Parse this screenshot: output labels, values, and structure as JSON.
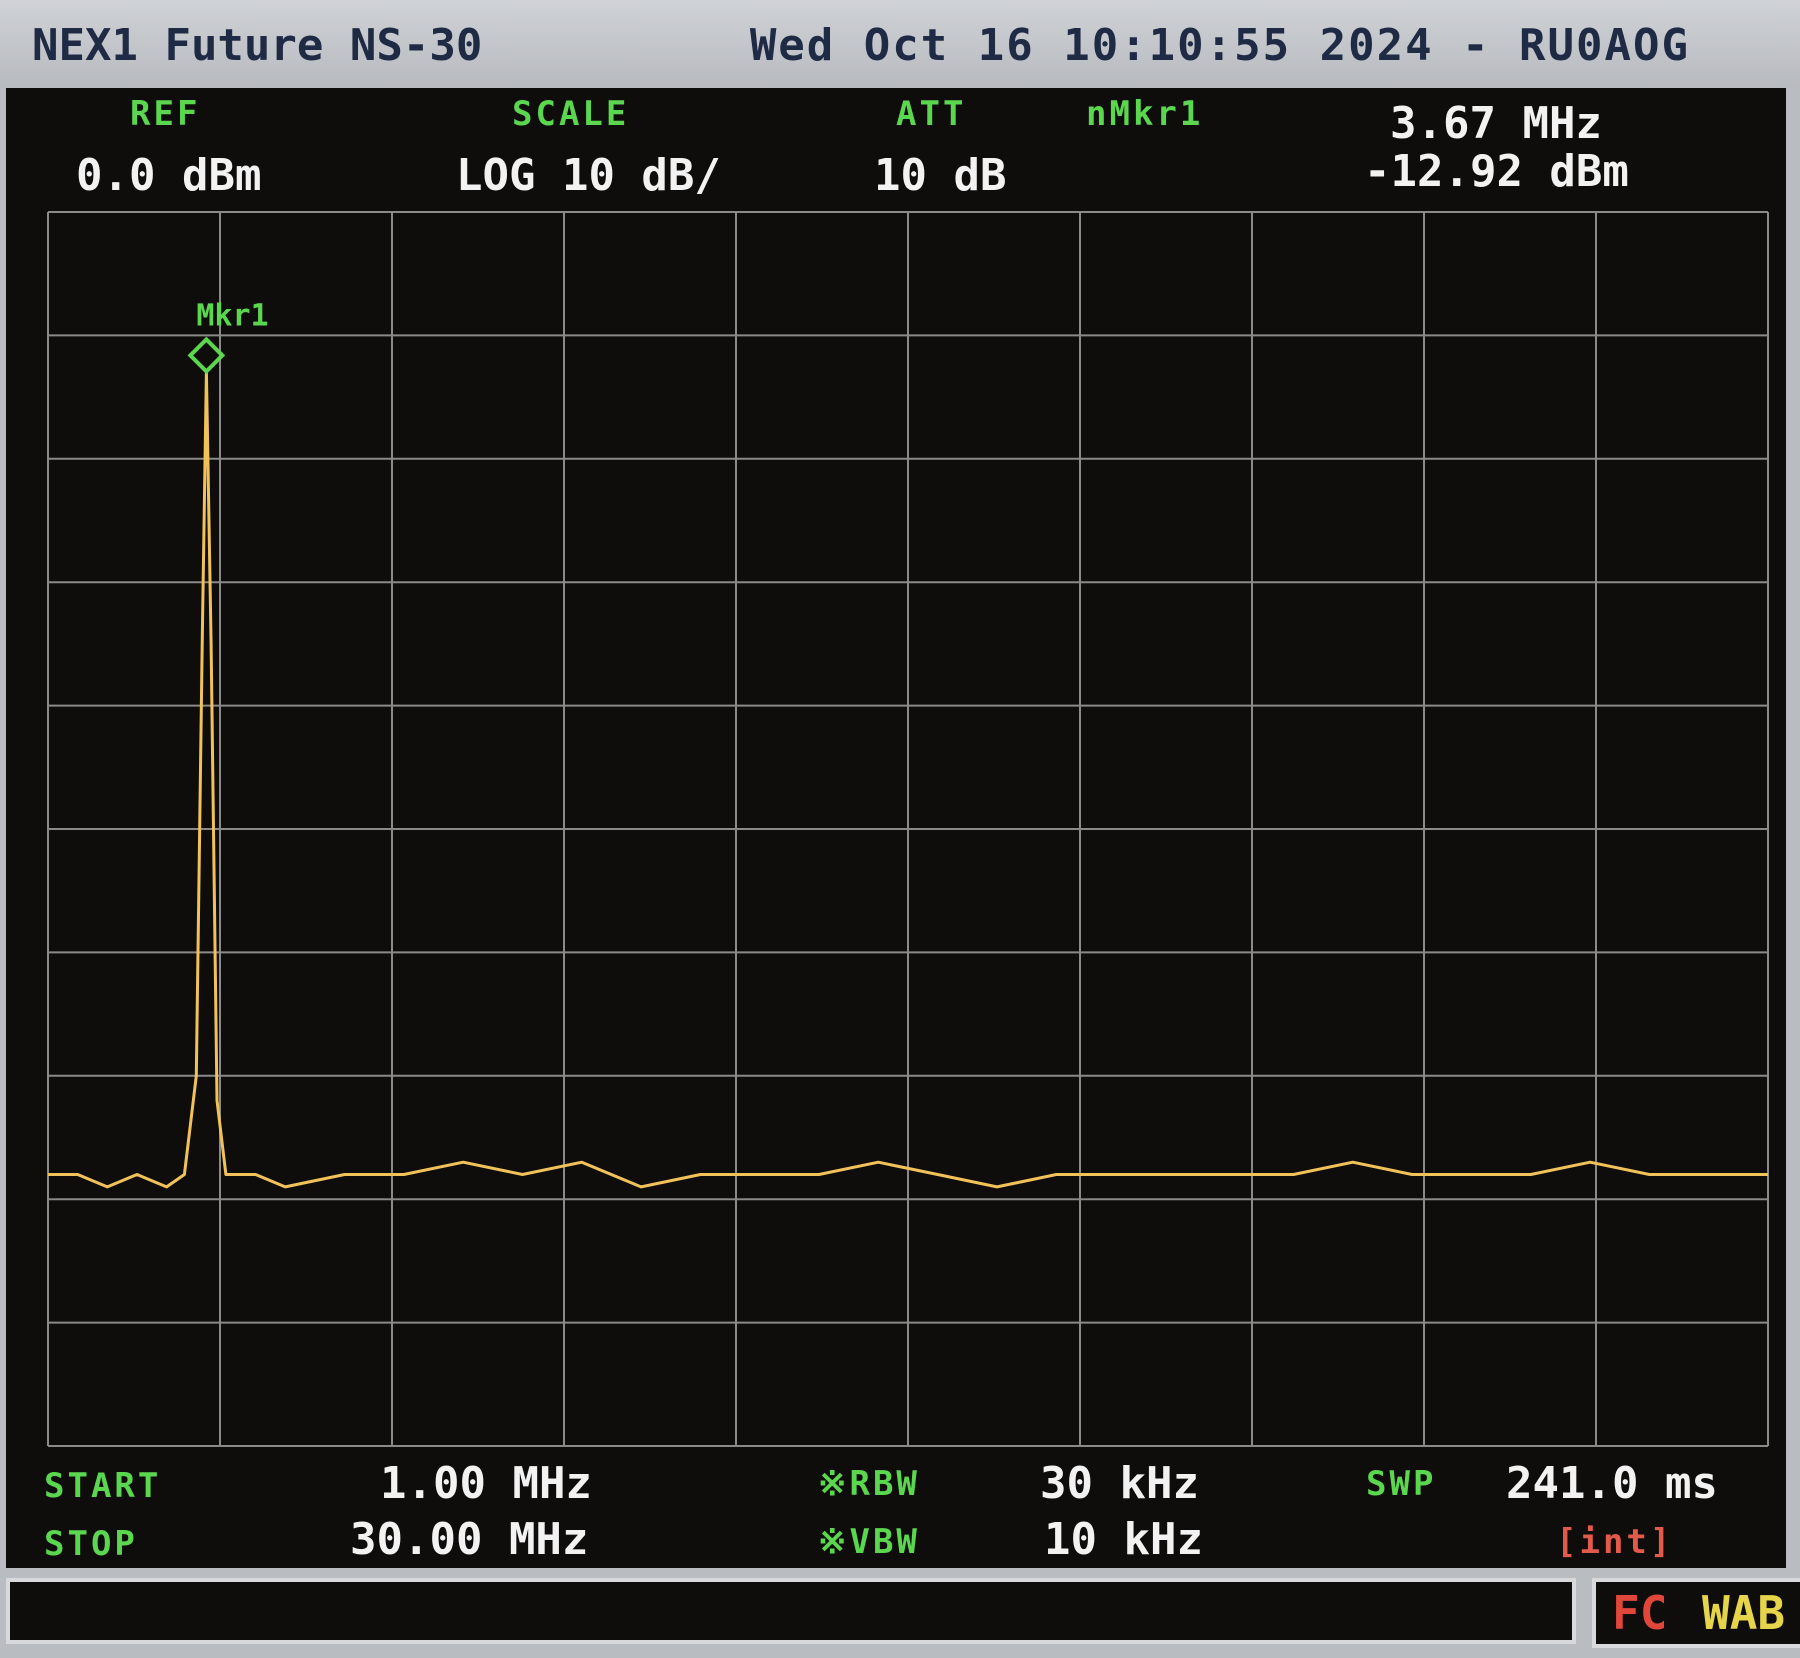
{
  "title": {
    "device": "NEX1 Future NS-30",
    "datetime_call": "Wed Oct 16 10:10:55 2024 - RU0AOG"
  },
  "header": {
    "ref_label": "REF",
    "ref_value": "0.0 dBm",
    "scale_label": "SCALE",
    "scale_value": "LOG 10 dB/",
    "att_label": "ATT",
    "att_value": "10 dB",
    "marker_label": "nMkr1",
    "marker_freq": "3.67 MHz",
    "marker_level": "-12.92 dBm"
  },
  "footer": {
    "start_label": "START",
    "start_value": "1.00 MHz",
    "stop_label": "STOP",
    "stop_value": "30.00 MHz",
    "rbw_label": "※RBW",
    "rbw_value": "30 kHz",
    "vbw_label": "※VBW",
    "vbw_value": "10 kHz",
    "swp_label": "SWP",
    "swp_value": "241.0 ms",
    "swp_mode": "[int]"
  },
  "status": {
    "fc": "FC",
    "wab": "WAB"
  },
  "colors": {
    "trace": "#f2c25a",
    "grid": "#8a8a8a",
    "label_green": "#5bd64f",
    "value_white": "#f2f2f2",
    "accent_red": "#e25a4a",
    "background": "#0f0d0c"
  },
  "chart_data": {
    "type": "line",
    "title": "",
    "xlabel": "",
    "ylabel": "",
    "xlim": [
      1.0,
      30.0
    ],
    "ylim": [
      -100,
      0
    ],
    "x_unit": "MHz",
    "y_unit": "dBm",
    "grid": true,
    "grid_divisions": {
      "x": 10,
      "y": 10
    },
    "marker": {
      "label": "Mkr1",
      "x": 3.67,
      "y": -12.92
    },
    "series": [
      {
        "x": [
          1.0,
          1.5,
          2.0,
          2.5,
          3.0,
          3.3,
          3.5,
          3.6,
          3.67,
          3.75,
          3.85,
          4.0,
          4.5,
          5.0,
          6.0,
          7.0,
          8.0,
          9.0,
          10.0,
          11.0,
          12.0,
          13.0,
          14.0,
          15.0,
          16.0,
          17.0,
          18.0,
          19.0,
          20.0,
          21.0,
          22.0,
          23.0,
          24.0,
          25.0,
          26.0,
          27.0,
          28.0,
          29.0,
          30.0
        ],
        "y": [
          -78,
          -78,
          -79,
          -78,
          -79,
          -78,
          -70,
          -35,
          -13,
          -35,
          -72,
          -78,
          -78,
          -79,
          -78,
          -78,
          -77,
          -78,
          -77,
          -79,
          -78,
          -78,
          -78,
          -77,
          -78,
          -79,
          -78,
          -78,
          -78,
          -78,
          -78,
          -77,
          -78,
          -78,
          -78,
          -77,
          -78,
          -78,
          -78
        ]
      }
    ]
  }
}
